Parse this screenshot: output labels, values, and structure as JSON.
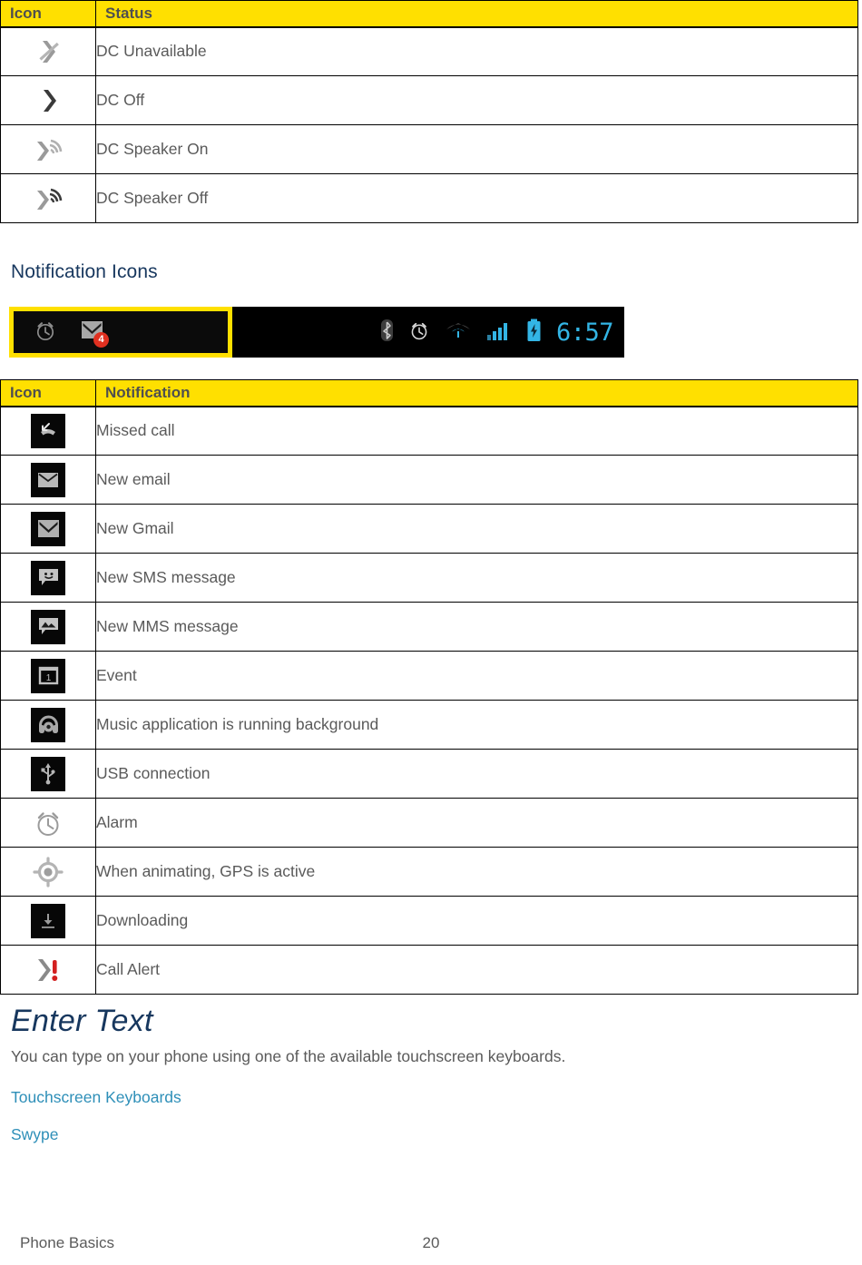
{
  "status_table": {
    "headers": [
      "Icon",
      "Status"
    ],
    "rows": [
      {
        "icon": "dc-unavailable-icon",
        "label": "DC Unavailable"
      },
      {
        "icon": "dc-off-icon",
        "label": "DC Off"
      },
      {
        "icon": "dc-speaker-on-icon",
        "label": "DC Speaker On"
      },
      {
        "icon": "dc-speaker-off-icon",
        "label": "DC Speaker Off"
      }
    ]
  },
  "section_heading": "Notification Icons",
  "statusbar": {
    "notification_icons": [
      "alarm-clock-icon",
      "gmail-icon"
    ],
    "gmail_badge": "4",
    "system_icons": [
      "bluetooth-icon",
      "alarm-clock-icon",
      "wifi-icon",
      "signal-bars-icon",
      "battery-charging-icon"
    ],
    "time": "6:57",
    "accent_color": "#33B5E5",
    "highlight_color": "#FFE000"
  },
  "notification_table": {
    "headers": [
      "Icon",
      "Notification"
    ],
    "rows": [
      {
        "icon": "missed-call-icon",
        "label": "Missed call"
      },
      {
        "icon": "new-email-icon",
        "label": "New email"
      },
      {
        "icon": "new-gmail-icon",
        "label": "New Gmail"
      },
      {
        "icon": "new-sms-icon",
        "label": "New SMS message"
      },
      {
        "icon": "new-mms-icon",
        "label": "New MMS message"
      },
      {
        "icon": "event-calendar-icon",
        "label": "Event"
      },
      {
        "icon": "music-headphones-icon",
        "label": "Music application is running background"
      },
      {
        "icon": "usb-connection-icon",
        "label": "USB connection"
      },
      {
        "icon": "alarm-clock-icon",
        "label": "Alarm"
      },
      {
        "icon": "gps-active-icon",
        "label": "When animating, GPS is active"
      },
      {
        "icon": "downloading-icon",
        "label": "Downloading"
      },
      {
        "icon": "call-alert-icon",
        "label": "Call Alert"
      }
    ]
  },
  "enter_text": {
    "title": "Enter Text",
    "paragraph": "You can type on your phone using one of the available touchscreen keyboards.",
    "links": [
      "Touchscreen Keyboards",
      "Swype"
    ]
  },
  "footer": {
    "left": "Phone Basics",
    "page_number": "20"
  },
  "colors": {
    "table_header_bg": "#FFE000",
    "heading_navy": "#17375E",
    "link_blue": "#2E8FB8",
    "body_gray": "#5A5A5A"
  }
}
